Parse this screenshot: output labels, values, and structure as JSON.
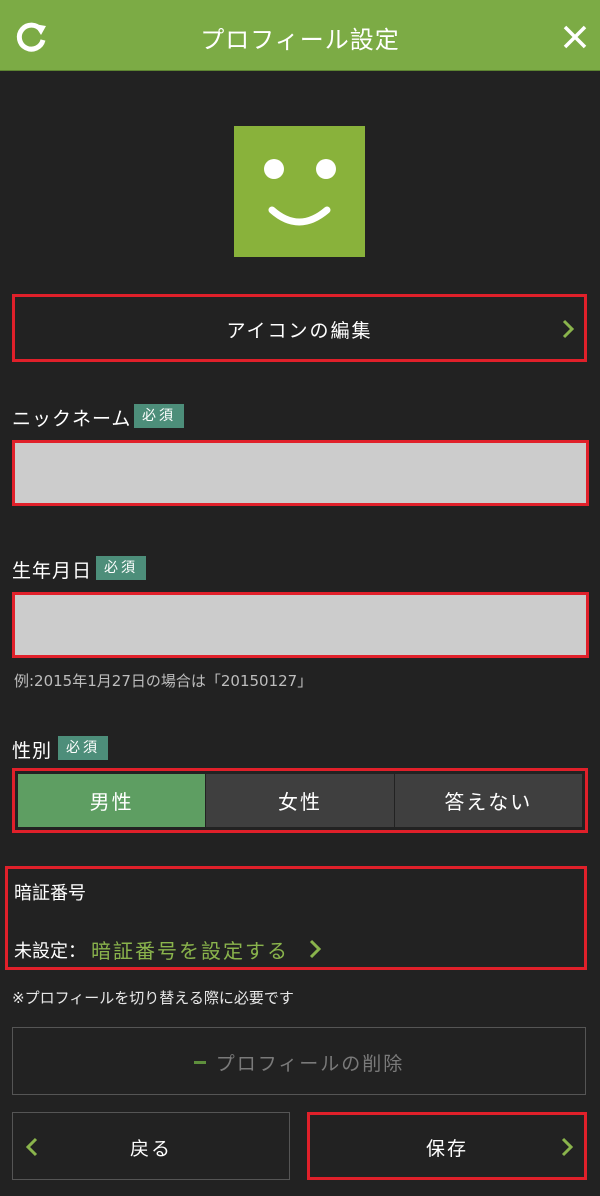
{
  "header": {
    "title": "プロフィール設定",
    "refresh_icon": "refresh-icon",
    "close_icon": "close-icon",
    "background": "#7cab45"
  },
  "avatar": {
    "icon": "smiley-face-icon",
    "color": "#89b23b"
  },
  "icon_edit": {
    "label": "アイコンの編集"
  },
  "nickname": {
    "label": "ニックネーム",
    "required": "必須",
    "value": ""
  },
  "birthday": {
    "label": "生年月日",
    "required": "必須",
    "value": "",
    "hint": "例:2015年1月27日の場合は「20150127」"
  },
  "gender": {
    "label": "性別",
    "required": "必須",
    "options": [
      "男性",
      "女性",
      "答えない"
    ],
    "selected": "男性"
  },
  "pin": {
    "title": "暗証番号",
    "status": "未設定：",
    "link": "暗証番号を設定する",
    "note": "※プロフィールを切り替える際に必要です"
  },
  "delete_button": {
    "label": "プロフィールの削除"
  },
  "back_button": {
    "label": "戻る"
  },
  "save_button": {
    "label": "保存"
  },
  "colors": {
    "accent_green": "#8ab44c",
    "badge": "#4d8e7a",
    "selected_segment": "#5e9e62",
    "highlight_border": "#e0202a",
    "background": "#222222"
  }
}
